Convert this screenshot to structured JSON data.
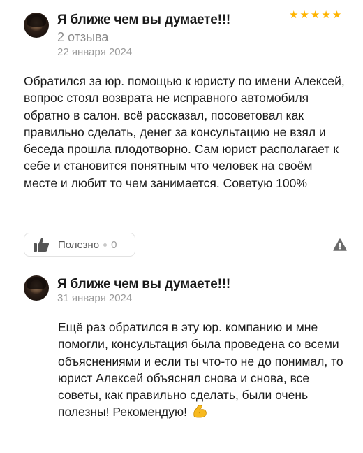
{
  "reviews": [
    {
      "author": "Я ближе чем вы думаете!!!",
      "review_count": "2 отзыва",
      "date": "22 января 2024",
      "rating": 5,
      "text": "Обратился за юр. помощью к юристу по имени Алексей, вопрос стоял возврата не исправного автомобиля обратно в салон. всё рассказал, посоветовал как правильно сделать, денег за консультацию не взял и беседа прошла плодотворно. Сам юрист располагает к себе и становится понятным что человек на своём месте и любит то чем занимается. Советую 100%",
      "helpful_label": "Полезно",
      "helpful_count": "0"
    },
    {
      "author": "Я ближе чем вы думаете!!!",
      "date": "31 января 2024",
      "text": "Ещё раз обратился в эту юр. компанию и мне помогли, консультация была проведена со всеми объяснениями и если ты что-то не до понимал, то юрист Алексей объяснял снова и снова, все советы, как правильно сделать, были очень полезны! Рекомендую!",
      "emoji": "flexed-biceps"
    }
  ],
  "icons": {
    "star_color": "#ffb400",
    "thumb": "thumbs-up-icon",
    "report": "warning-icon"
  }
}
